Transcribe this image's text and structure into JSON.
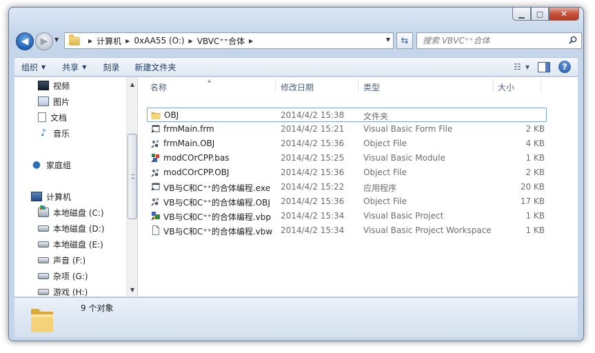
{
  "window": {
    "caption_min": "▁",
    "caption_max": "□",
    "caption_close": "✕"
  },
  "address": {
    "crumbs": [
      "计算机",
      "0xAA55 (O:)",
      "VBVC⁺⁺合体"
    ],
    "search_placeholder": "搜索 VBVC⁺⁺合体"
  },
  "toolbar": {
    "organize": "组织",
    "share": "共享",
    "burn": "刻录",
    "new_folder": "新建文件夹"
  },
  "nav": {
    "items": [
      {
        "label": "视频",
        "icon": "video-library-icon"
      },
      {
        "label": "图片",
        "icon": "pictures-library-icon"
      },
      {
        "label": "文档",
        "icon": "documents-library-icon"
      },
      {
        "label": "音乐",
        "icon": "music-library-icon"
      },
      {
        "label": "家庭组",
        "icon": "homegroup-icon"
      },
      {
        "label": "计算机",
        "icon": "computer-icon"
      },
      {
        "label": "本地磁盘 (C:)",
        "icon": "system-drive-icon"
      },
      {
        "label": "本地磁盘 (D:)",
        "icon": "drive-icon"
      },
      {
        "label": "本地磁盘 (E:)",
        "icon": "drive-icon"
      },
      {
        "label": "声音 (F:)",
        "icon": "drive-icon"
      },
      {
        "label": "杂项 (G:)",
        "icon": "drive-icon"
      },
      {
        "label": "游戏 (H:)",
        "icon": "drive-icon"
      }
    ]
  },
  "columns": {
    "name": "名称",
    "date": "修改日期",
    "type": "类型",
    "size": "大小"
  },
  "files": [
    {
      "name": "OBJ",
      "date": "2014/4/2 15:38",
      "type": "文件夹",
      "size": "",
      "icon": "folder-icon"
    },
    {
      "name": "frmMain.frm",
      "date": "2014/4/2 15:21",
      "type": "Visual Basic Form File",
      "size": "2 KB",
      "icon": "vb-form-icon"
    },
    {
      "name": "frmMain.OBJ",
      "date": "2014/4/2 15:36",
      "type": "Object File",
      "size": "4 KB",
      "icon": "object-file-icon"
    },
    {
      "name": "modCOrCPP.bas",
      "date": "2014/4/2 15:25",
      "type": "Visual Basic Module",
      "size": "1 KB",
      "icon": "vb-module-icon"
    },
    {
      "name": "modCOrCPP.OBJ",
      "date": "2014/4/2 15:36",
      "type": "Object File",
      "size": "2 KB",
      "icon": "object-file-icon"
    },
    {
      "name": "VB与C和C⁺⁺的合体编程.exe",
      "date": "2014/4/2 15:22",
      "type": "应用程序",
      "size": "20 KB",
      "icon": "application-icon"
    },
    {
      "name": "VB与C和C⁺⁺的合体编程.OBJ",
      "date": "2014/4/2 15:36",
      "type": "Object File",
      "size": "17 KB",
      "icon": "object-file-icon"
    },
    {
      "name": "VB与C和C⁺⁺的合体编程.vbp",
      "date": "2014/4/2 15:34",
      "type": "Visual Basic Project",
      "size": "1 KB",
      "icon": "vb-project-icon"
    },
    {
      "name": "VB与C和C⁺⁺的合体编程.vbw",
      "date": "2014/4/2 15:34",
      "type": "Visual Basic Project Workspace",
      "size": "1 KB",
      "icon": "blank-file-icon"
    }
  ],
  "status": {
    "count_text": "9 个对象"
  }
}
